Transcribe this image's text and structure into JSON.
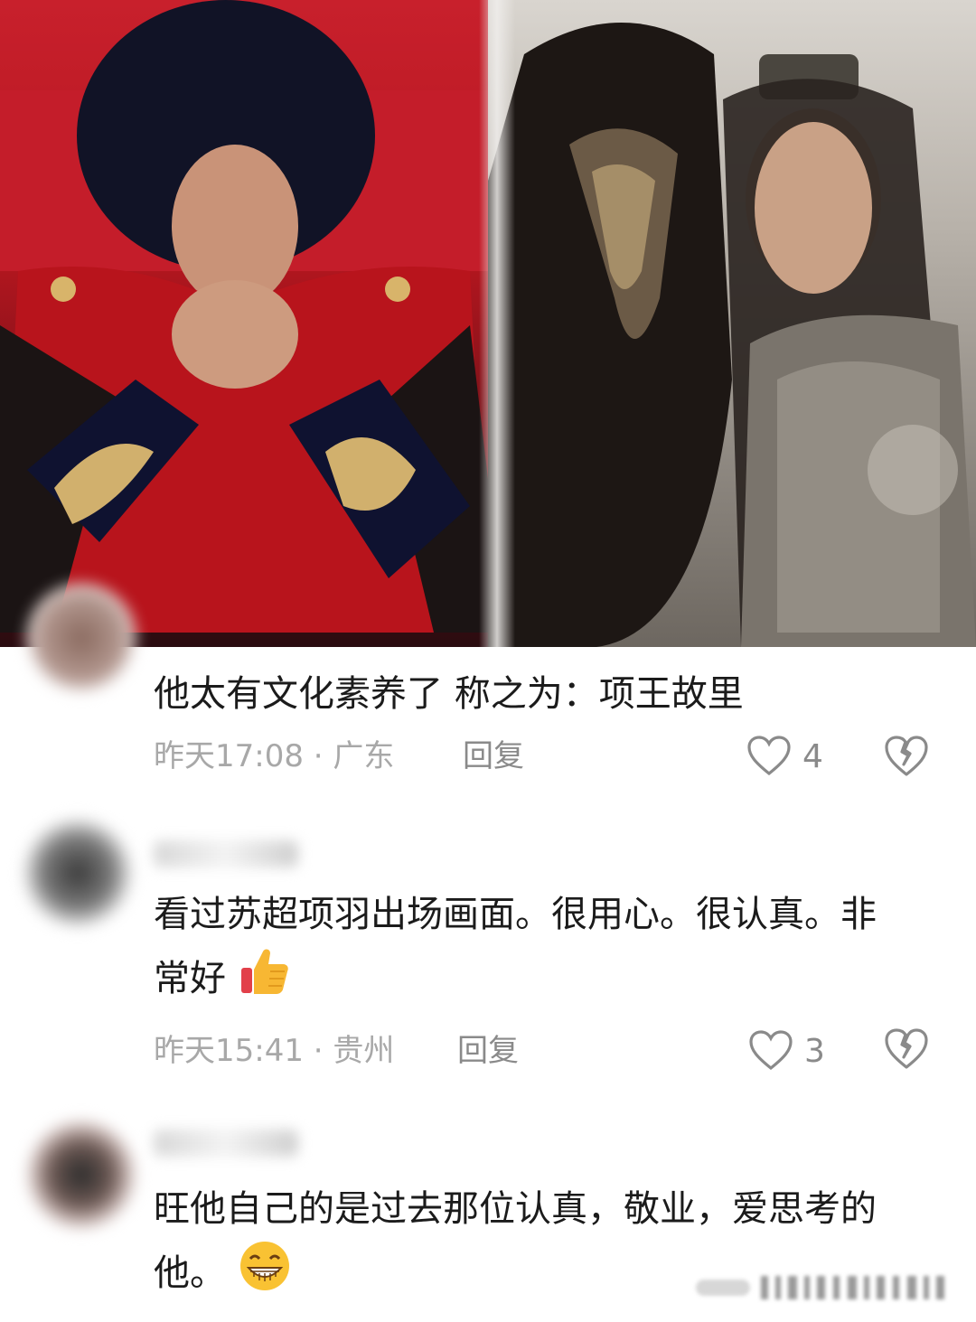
{
  "comments": [
    {
      "text": "他太有文化素养了 称之为：项王故里",
      "time": "昨天17:08",
      "sep": "·",
      "location": "广东",
      "reply_label": "回复",
      "likes": "4",
      "emoji": ""
    },
    {
      "text": "看过苏超项羽出场画面。很用心。很认真。非常好",
      "time": "昨天15:41",
      "sep": "·",
      "location": "贵州",
      "reply_label": "回复",
      "likes": "3",
      "emoji": "thumbs-up"
    },
    {
      "text": "旺他自己的是过去那位认真，敬业，爱思考的他。",
      "emoji": "grinning-face"
    }
  ],
  "icons": {
    "like": "heart-outline-icon",
    "dislike": "broken-heart-icon"
  }
}
